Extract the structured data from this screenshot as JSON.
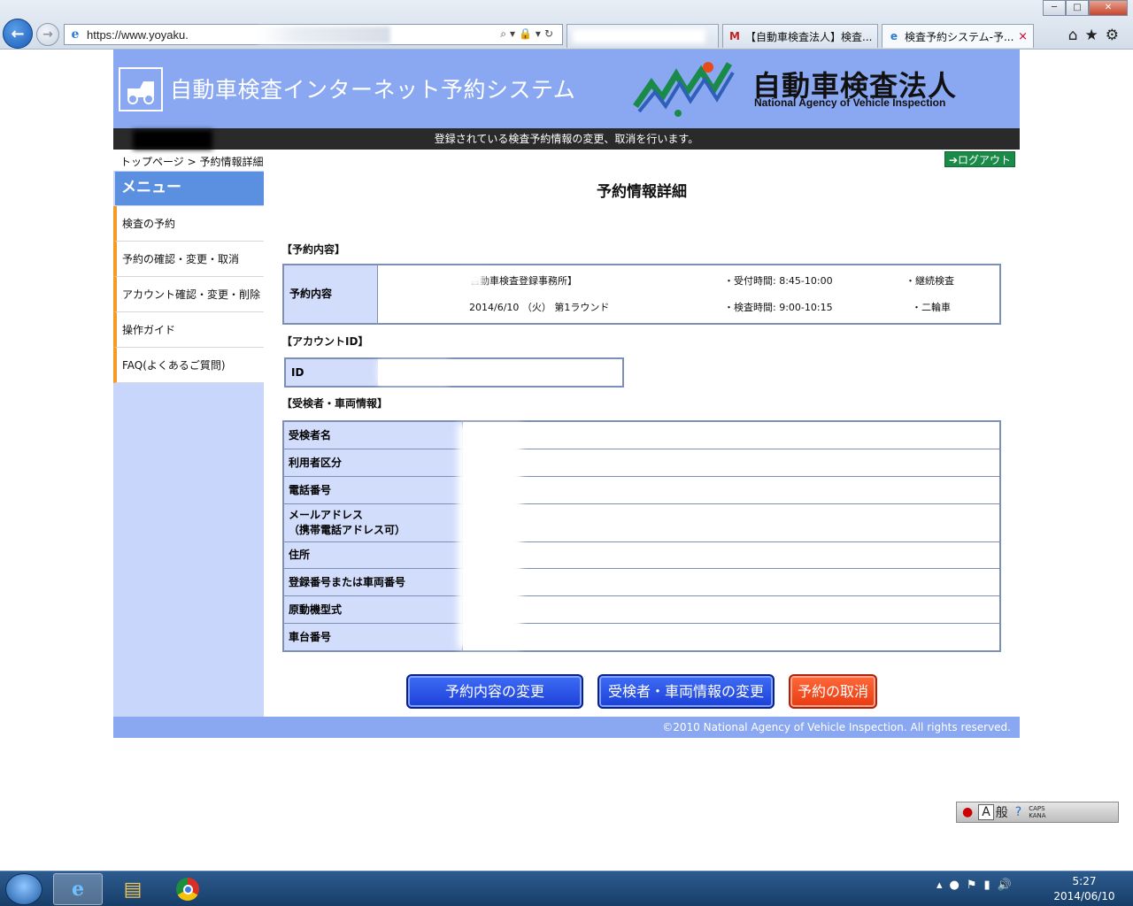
{
  "browser": {
    "url": "https://www.yoyaku.",
    "tabs": [
      {
        "label": ""
      },
      {
        "label": "【自動車検査法人】検査..."
      },
      {
        "label": "検査予約システム-予..."
      }
    ],
    "tab_close_glyph": "×",
    "window_buttons": {
      "minimize": "─",
      "maximize": "□",
      "close": "✕"
    },
    "tool_icons": [
      "home-icon",
      "star-icon",
      "gear-icon"
    ]
  },
  "site": {
    "title": "自動車検査インターネット予約システム",
    "agency_name": "自動車検査法人",
    "agency_name_en": "National Agency of Vehicle Inspection",
    "info_message": "登録されている検査予約情報の変更、取消を行います。",
    "breadcrumb": "トップページ > 予約情報詳細",
    "logout_label": "➔ログアウト",
    "footer": "©2010 National Agency of Vehicle Inspection. All rights reserved."
  },
  "sidebar": {
    "header": "メニュー",
    "items": [
      {
        "label": "検査の予約"
      },
      {
        "label": "予約の確認・変更・取消"
      },
      {
        "label": "アカウント確認・変更・削除"
      },
      {
        "label": "操作ガイド"
      },
      {
        "label": "FAQ(よくあるご質問)"
      }
    ]
  },
  "main": {
    "title": "予約情報詳細",
    "reservation_section": "【予約内容】",
    "reservation": {
      "head": "予約内容",
      "office": "自動車検査登録事務所】",
      "reception_time": "・受付時間: 8:45-10:00",
      "inspection_type": "・継続検査",
      "date_round": "2014/6/10 （火） 第1ラウンド",
      "inspection_time": "・検査時間: 9:00-10:15",
      "vehicle_type": "・二輪車"
    },
    "account_section": "【アカウントID】",
    "account": {
      "head": "ID"
    },
    "info_section": "【受検者・車両情報】",
    "info_rows": [
      {
        "label": "受検者名"
      },
      {
        "label": "利用者区分"
      },
      {
        "label": "電話番号"
      },
      {
        "label": "メールアドレス\n（携帯電話アドレス可）"
      },
      {
        "label": "住所"
      },
      {
        "label": "登録番号または車両番号"
      },
      {
        "label": "原動機型式"
      },
      {
        "label": "車台番号"
      }
    ],
    "buttons": {
      "change_reservation": "予約内容の変更",
      "change_info": "受検者・車両情報の変更",
      "cancel": "予約の取消"
    }
  },
  "ime": {
    "mode_a": "A",
    "mode_kanji": "般",
    "caps": "CAPS",
    "kana": "KANA"
  },
  "taskbar": {
    "time": "5:27",
    "date": "2014/06/10"
  }
}
